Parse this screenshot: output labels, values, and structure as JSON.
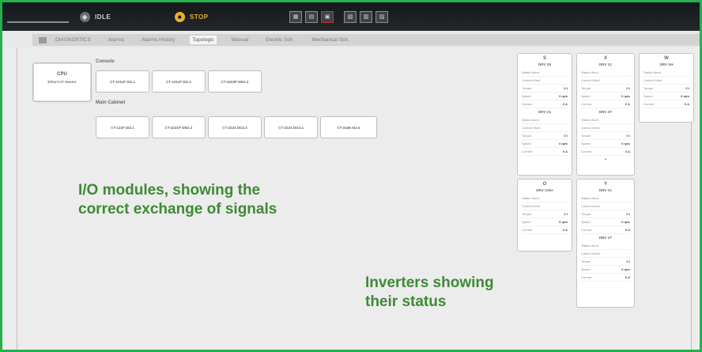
{
  "topbar": {
    "idle_label": "IDLE",
    "stop_label": "STOP",
    "tools": [
      "tool-1",
      "tool-2",
      "tool-3",
      "tool-4",
      "tool-5",
      "tool-6"
    ]
  },
  "tabs": {
    "diagnostics": "DIAGNOSTICS",
    "items": [
      "Alarms",
      "Alarms History",
      "Topologic",
      "Manual",
      "Electric Sch.",
      "Mechanical Sch."
    ],
    "selected_index": 2
  },
  "cpu": {
    "title": "CPU",
    "subtitle": "EtherCAT Master"
  },
  "console": {
    "label": "Console",
    "modules": [
      "CT-1211P DI1.1",
      "CT-1211P DI1.2",
      "CT-4223P DM1.4"
    ]
  },
  "main_cabinet": {
    "label": "Main Cabinet",
    "modules": [
      "CT-121F DI2.1",
      "CT-4231P DM2.2",
      "CT-2224 DO2.3",
      "CT-2224 DO2.4",
      "CT-3168 AI2.5"
    ]
  },
  "inverters": {
    "S": {
      "axis": "S",
      "top": {
        "drv": "DRV X0",
        "status_word": "Status Word",
        "control_word": "Control Word",
        "torque": "Torque",
        "torque_v": "0 t",
        "speed": "Speed",
        "speed_v": "0 rpm",
        "current": "Current",
        "current_v": "0 A"
      },
      "bottom": {
        "drv": "DRV X1",
        "status_word": "Status Word",
        "control_word": "Control Word",
        "torque": "Torque",
        "torque_v": "0 t",
        "speed": "Speed",
        "speed_v": "0 rpm",
        "current": "Current",
        "current_v": "0 A"
      }
    },
    "X": {
      "axis": "X",
      "top": {
        "drv": "DRV X1",
        "status_word": "Status Word",
        "control_word": "Control Word",
        "torque": "Torque",
        "torque_v": "0 t",
        "speed": "Speed",
        "speed_v": "0 rpm",
        "current": "Current",
        "current_v": "0 A"
      },
      "bottom": {
        "drv": "DRV XT",
        "status_word": "Status Word",
        "control_word": "Control Word",
        "torque": "Torque",
        "torque_v": "0 t",
        "speed": "Speed",
        "speed_v": "0 rpm",
        "current": "Current",
        "current_v": "0 A"
      }
    },
    "W": {
      "axis": "W",
      "top": {
        "drv": "DRV XH",
        "status_word": "Status Word",
        "control_word": "Control Word",
        "torque": "Torque",
        "torque_v": "0 t",
        "speed": "Speed",
        "speed_v": "0 rpm",
        "current": "Current",
        "current_v": "0 A"
      }
    },
    "O": {
      "axis": "O",
      "top": {
        "drv": "DRV Vsbe",
        "status_word": "Status Word",
        "control_word": "Control Word",
        "torque": "Torque",
        "torque_v": "0 t",
        "speed": "Speed",
        "speed_v": "0 rpm",
        "current": "Current",
        "current_v": "0 A"
      }
    },
    "Y": {
      "axis": "Y",
      "top": {
        "drv": "DRV Vc",
        "status_word": "Status Word",
        "control_word": "Control Word",
        "torque": "Torque",
        "torque_v": "0 t",
        "speed": "Speed",
        "speed_v": "0 rpm",
        "current": "Current",
        "current_v": "0 A"
      },
      "bottom": {
        "drv": "DRV VT",
        "status_word": "Status Word",
        "control_word": "Control Word",
        "torque": "Torque",
        "torque_v": "0 t",
        "speed": "Speed",
        "speed_v": "0 rpm",
        "current": "Current",
        "current_v": "0 A"
      }
    }
  },
  "notes": {
    "io_line1": "I/O modules, showing the",
    "io_line2": "correct exchange of signals",
    "inv_line1": "Inverters showing",
    "inv_line2": "their status"
  },
  "colors": {
    "frame": "#22b14c",
    "note": "#3e8a35",
    "stop": "#e3b22d"
  }
}
